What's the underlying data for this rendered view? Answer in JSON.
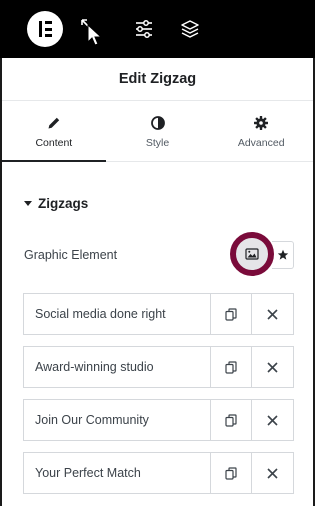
{
  "panel": {
    "title": "Edit Zigzag"
  },
  "topbar": {
    "icons": [
      "elementor-logo-icon",
      "cursor-icon",
      "sliders-icon",
      "layers-icon"
    ]
  },
  "tabs": [
    {
      "label": "Content",
      "icon": "pencil-icon",
      "active": true
    },
    {
      "label": "Style",
      "icon": "contrast-icon",
      "active": false
    },
    {
      "label": "Advanced",
      "icon": "gear-icon",
      "active": false
    }
  ],
  "section": {
    "title": "Zigzags"
  },
  "graphic_control": {
    "label": "Graphic Element",
    "options": [
      "image-icon",
      "star-icon"
    ]
  },
  "items": [
    {
      "title": "Social media done right"
    },
    {
      "title": "Award-winning studio"
    },
    {
      "title": "Join Our Community"
    },
    {
      "title": "Your Perfect Match"
    }
  ],
  "colors": {
    "topbar": "#000000",
    "highlight_ring": "#7a0b3a",
    "text": "#1f2124",
    "border": "#d5d8dc"
  }
}
